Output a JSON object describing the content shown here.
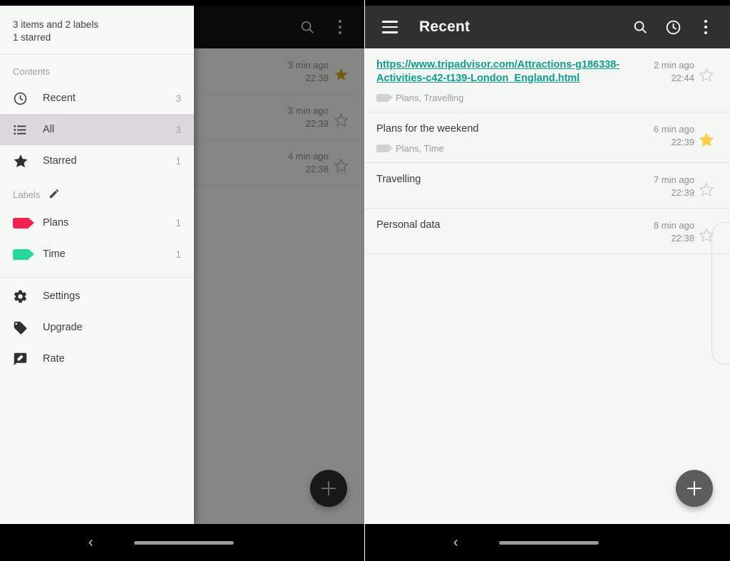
{
  "colors": {
    "appbar": "#2e312e",
    "appbar_plain": "#111411",
    "link": "#0f9e8d",
    "star_filled": "#ffce45",
    "star_empty": "#cfd2cd",
    "label_plans": "#f3224f",
    "label_time": "#28d79b",
    "drawer_bg": "#f6faf5",
    "selected_row": "#dcd8de",
    "scrim": "rgba(0,0,0,0.46)",
    "fab_right": "#5c5c5c",
    "fab_left": "#2b2e2b"
  },
  "left_screen": {
    "appbar": {
      "search_icon": "search-icon",
      "overflow_icon": "more-vertical-icon"
    },
    "rows": [
      {
        "meta_ago": "3 min ago",
        "meta_time": "22:39",
        "starred": true
      },
      {
        "meta_ago": "3 min ago",
        "meta_time": "22:39",
        "starred": false
      },
      {
        "meta_ago": "4 min ago",
        "meta_time": "22:38",
        "starred": false
      }
    ],
    "fab_label": "+",
    "navbar": {
      "back": "‹"
    },
    "drawer": {
      "summary_line1": "3 items and 2 labels",
      "summary_line2": "1 starred",
      "contents_title": "Contents",
      "contents": [
        {
          "icon": "clock-icon",
          "label": "Recent",
          "count": "3",
          "selected": false
        },
        {
          "icon": "list-icon",
          "label": "All",
          "count": "3",
          "selected": true
        },
        {
          "icon": "star-icon",
          "label": "Starred",
          "count": "1",
          "selected": false
        }
      ],
      "labels_title": "Labels",
      "labels_edit_icon": "pencil-icon",
      "labels": [
        {
          "icon": "tag-icon",
          "color_key": "plans",
          "label": "Plans",
          "count": "1"
        },
        {
          "icon": "tag-icon",
          "color_key": "time",
          "label": "Time",
          "count": "1"
        }
      ],
      "actions": [
        {
          "icon": "gear-icon",
          "label": "Settings"
        },
        {
          "icon": "price-tag-icon",
          "label": "Upgrade"
        },
        {
          "icon": "rate-pencil-icon",
          "label": "Rate"
        }
      ]
    }
  },
  "right_screen": {
    "appbar": {
      "menu_icon": "hamburger-menu-icon",
      "title": "Recent",
      "search_icon": "search-icon",
      "history_icon": "history-clock-icon",
      "overflow_icon": "more-vertical-icon"
    },
    "items": [
      {
        "title": "https://www.tripadvisor.com/Attractions-g186338-Activities-c42-t139-London_England.html",
        "is_link": true,
        "labels": "Plans, Travelling",
        "meta_ago": "2 min ago",
        "meta_time": "22:44",
        "starred": false
      },
      {
        "title": "Plans for the weekend",
        "is_link": false,
        "labels": "Plans, Time",
        "meta_ago": "6 min ago",
        "meta_time": "22:39",
        "starred": true
      },
      {
        "title": "Travelling",
        "is_link": false,
        "labels": "",
        "meta_ago": "7 min ago",
        "meta_time": "22:39",
        "starred": false
      },
      {
        "title": "Personal data",
        "is_link": false,
        "labels": "",
        "meta_ago": "8 min ago",
        "meta_time": "22:38",
        "starred": false
      }
    ],
    "fab_label": "+",
    "navbar": {
      "back": "‹"
    }
  }
}
